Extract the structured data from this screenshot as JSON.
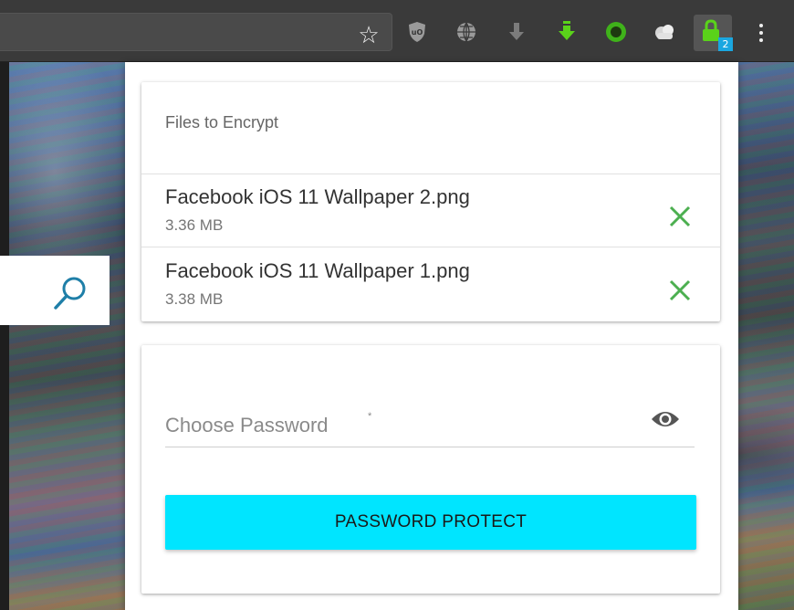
{
  "browser": {
    "toolbar": {
      "star_icon": "star-icon",
      "extensions": [
        "ublock-origin-icon",
        "globe-icon",
        "download-grey-icon",
        "download-green-icon",
        "green-circle-icon",
        "cloud-icon",
        "lock-extension-icon"
      ],
      "lock_badge": "2",
      "menu_icon": "more-vert-icon"
    }
  },
  "page": {
    "search_icon": "search-icon"
  },
  "popup": {
    "files_title": "Files to Encrypt",
    "files": [
      {
        "name": "Facebook iOS 11 Wallpaper 2.png",
        "size": "3.36 MB"
      },
      {
        "name": "Facebook iOS 11 Wallpaper 1.png",
        "size": "3.38 MB"
      }
    ],
    "password_placeholder": "Choose Password",
    "required_mark": "*",
    "protect_label": "PASSWORD PROTECT"
  },
  "colors": {
    "accent": "#00e5ff",
    "remove_icon": "#4caf50",
    "badge": "#1aa7e0"
  }
}
